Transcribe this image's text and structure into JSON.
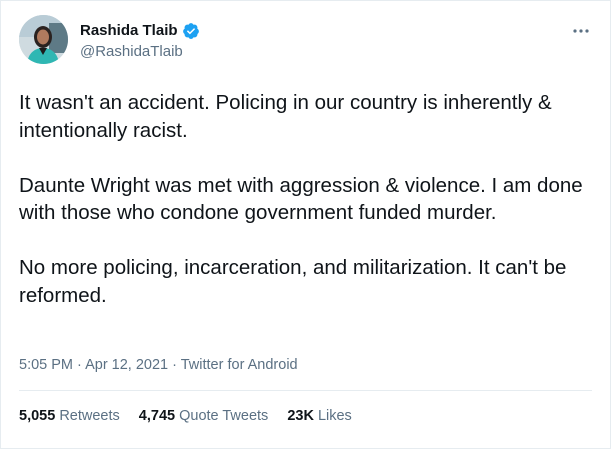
{
  "colors": {
    "verified_badge": "#1da1f2",
    "secondary_text": "#5b7083",
    "primary_text": "#0f1419",
    "divider": "#e6ecf0"
  },
  "author": {
    "display_name": "Rashida Tlaib",
    "handle": "@RashidaTlaib",
    "verified": true
  },
  "tweet": {
    "paragraphs": [
      "It wasn't an accident. Policing in our country is inherently & intentionally racist.",
      "Daunte Wright was met with aggression & violence. I am done with those who condone government funded murder.",
      "No more policing, incarceration, and militarization. It can't be reformed."
    ],
    "timestamp": "5:05 PM · Apr 12, 2021",
    "separator": " · ",
    "source": "Twitter for Android"
  },
  "stats": {
    "retweets_count": "5,055",
    "retweets_label": "Retweets",
    "quote_tweets_count": "4,745",
    "quote_tweets_label": "Quote Tweets",
    "likes_count": "23K",
    "likes_label": "Likes"
  }
}
